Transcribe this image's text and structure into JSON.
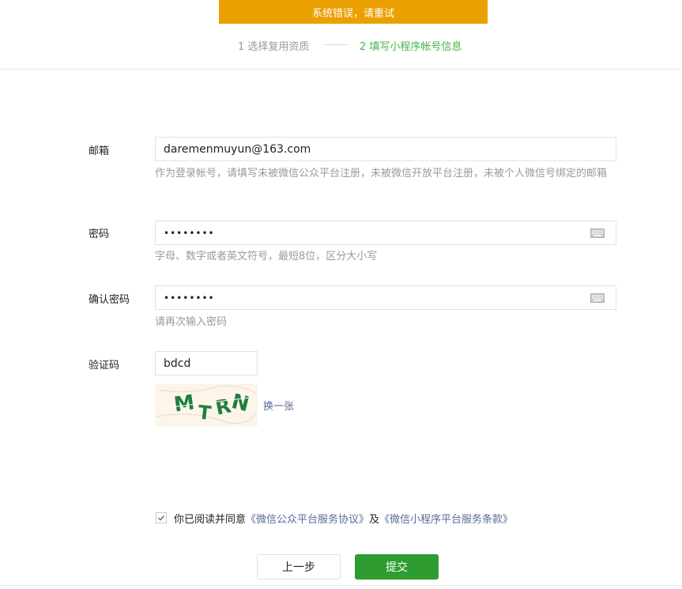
{
  "banner": {
    "text": "系统错误，请重试"
  },
  "steps": {
    "step1": "1 选择复用资质",
    "step2": "2 填写小程序帐号信息"
  },
  "form": {
    "email": {
      "label": "邮箱",
      "value": "daremenmuyun@163.com",
      "hint": "作为登录帐号，请填写未被微信公众平台注册，未被微信开放平台注册，未被个人微信号绑定的邮箱"
    },
    "password": {
      "label": "密码",
      "value": "••••••••",
      "hint": "字母、数字或者英文符号，最短8位，区分大小写",
      "icon": "keyboard-icon"
    },
    "confirm_password": {
      "label": "确认密码",
      "value": "••••••••",
      "hint": "请再次输入密码",
      "icon": "keyboard-icon"
    },
    "captcha": {
      "label": "验证码",
      "value": "bdcd",
      "image_text": "MTRN",
      "refresh_label": "换一张"
    }
  },
  "agreement": {
    "checked": true,
    "prefix": "你已阅读并同意",
    "link1": "《微信公众平台服务协议》",
    "joiner": "及",
    "link2": "《微信小程序平台服务条款》"
  },
  "buttons": {
    "prev_label": "上一步",
    "submit_label": "提交"
  },
  "colors": {
    "banner": "#eaa000",
    "active_step": "#44b549",
    "link": "#576b95",
    "submit": "#2e9c31"
  }
}
